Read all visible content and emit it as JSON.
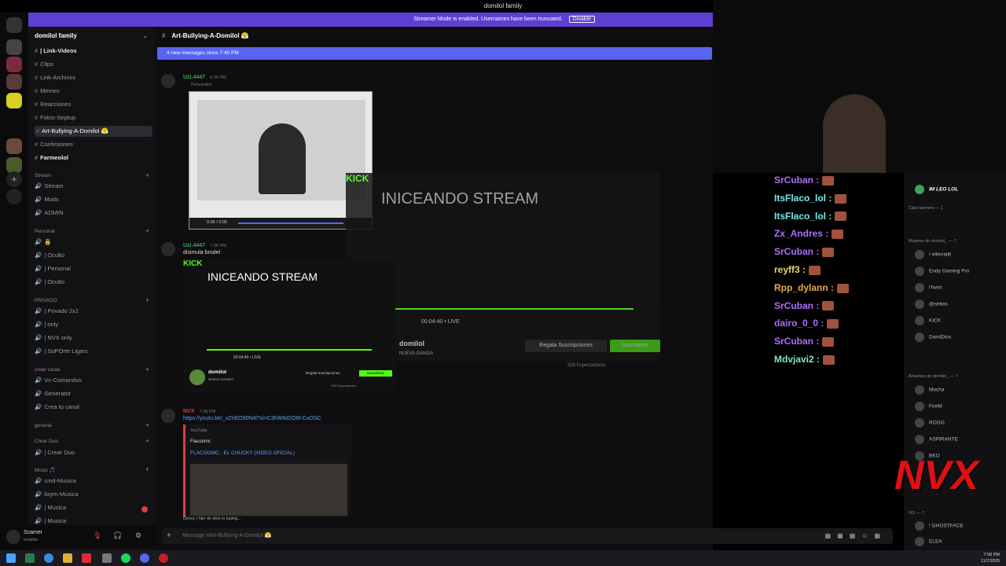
{
  "titlebar": {
    "title": "domilol family"
  },
  "banner": {
    "text": "Streamer Mode is enabled. Usernames have been truncated.",
    "disable_label": "Disable"
  },
  "server": {
    "name": "domilol family"
  },
  "channel_header": {
    "name": "Art-Bullying-A-Domilol",
    "emoji": "😤"
  },
  "new_messages": {
    "text": "4 new messages since 7:40 PM"
  },
  "channels": [
    {
      "label": "| Link-Videos",
      "style": "bright"
    },
    {
      "label": "Clips"
    },
    {
      "label": "Link-Archivos"
    },
    {
      "label": "Memes"
    },
    {
      "label": "Reacciones"
    },
    {
      "label": "Fotos-Septup"
    },
    {
      "label": "Art-Bullying-A-Domilol 😤",
      "style": "active"
    },
    {
      "label": "Confesiones"
    },
    {
      "label": "Farmeolol",
      "style": "bright"
    }
  ],
  "categories": {
    "streams": "Stream",
    "personal": "Personal",
    "privado": "PRIVADO",
    "crear_canal": "crear canal",
    "general": "general",
    "crear_duo": "Crear Duo",
    "music": "Music 🎵"
  },
  "voice_stream": [
    {
      "label": "Stream"
    },
    {
      "label": "Mods"
    },
    {
      "label": "ADMIN"
    }
  ],
  "voice_personal": [
    {
      "label": "🔒"
    },
    {
      "label": "| Oculto"
    },
    {
      "label": "| Personal"
    },
    {
      "label": "| Oculto"
    }
  ],
  "voice_privado": [
    {
      "label": "| Privado 2x2"
    },
    {
      "label": "| only"
    },
    {
      "label": "| NVX only"
    },
    {
      "label": "| SoPOrte Ligars"
    }
  ],
  "voice_crear": [
    {
      "label": "Vc-Comandos"
    },
    {
      "label": "Generator"
    },
    {
      "label": "Crea tu canal"
    }
  ],
  "voice_duo": [
    {
      "label": "| Crear Duo"
    }
  ],
  "voice_music": [
    {
      "label": "cmd-Musica"
    },
    {
      "label": "lixym-Musica"
    },
    {
      "label": "| Musica"
    },
    {
      "label": "| Musica"
    }
  ],
  "messages": {
    "m1_user": "Uzi.4447",
    "m1_time": "6:26 PM",
    "m1_forwarded": "Forwarded",
    "m1_video_time": "0:06 / 0:06",
    "m2_user": "Uzi.4447",
    "m2_time": "7:38 PM",
    "m2_text": "disimula brodel",
    "m3_user": "NVX",
    "m3_time": "7:38 PM",
    "m3_link": "https://youtu.be/_xZnEO90N4l?si=C3hW6d2OM-CuOSC",
    "embed_site": "YouTube",
    "embed_author": "Flacoomc",
    "embed_title": "FLACOOMC - EL CHUCKY (VIDEO OFICIAL)",
    "typing": "Dexxy | hijo de dios is typing..."
  },
  "stream_overlay": {
    "title": "INICEANDO STREAM",
    "live_time": "00:04:40",
    "live_label": "LIVE",
    "streamer": "domilol",
    "tagline": "NUEVA GANGA",
    "gift_label": "Regala Suscripciones",
    "sub_label": "Suscribirse",
    "viewers": "328 Espectadores",
    "kick": "KICK"
  },
  "stream_chat": [
    {
      "user": "SrCuban :",
      "color": "#b06cff"
    },
    {
      "user": "ItsFlaco_lol :",
      "color": "#7ee6e6"
    },
    {
      "user": "ItsFlaco_lol :",
      "color": "#7ee6e6"
    },
    {
      "user": "Zx_Andres :",
      "color": "#b06cff"
    },
    {
      "user": "SrCuban :",
      "color": "#b06cff"
    },
    {
      "user": "reyff3 :",
      "color": "#e8d66a"
    },
    {
      "user": "Rpp_dylann :",
      "color": "#e8a94a"
    },
    {
      "user": "SrCuban :",
      "color": "#b06cff"
    },
    {
      "user": "dairo_0_0 :",
      "color": "#b06cff"
    },
    {
      "user": "SrCuban :",
      "color": "#b06cff"
    },
    {
      "user": "Mdvjavi2 :",
      "color": "#7ee6c0"
    }
  ],
  "members": {
    "top_name": "IM LEO LOL",
    "cat1": "Clips farmers — 1",
    "cat2": "Mujeres de domilol_ — 7",
    "cat3": "Amantes de domilol_ — 7",
    "cat4": "OG — 7",
    "list2": [
      "! elferralill",
      "Endy Gaming Pro",
      "iTwist",
      "@sebas",
      "KICK",
      "DomiDios"
    ],
    "list3": [
      "Mocha",
      "FireM",
      "ROGG",
      "ASPIRANTE",
      "BKO"
    ],
    "list4": [
      "! GHOSTFACE",
      "ELEA",
      "lil.uis7"
    ]
  },
  "user": {
    "name": "Scamer",
    "status": "Invisible"
  },
  "composer": {
    "placeholder": "Message #Art-Bullying-A-Domilol 😤"
  },
  "clock": {
    "time": "7:58 PM",
    "date": "11/7/2025"
  },
  "brand": {
    "nvx": "NVX"
  },
  "colors": {
    "banner": "#5d3fd3",
    "accent": "#5865f2",
    "kick_green": "#53fc18"
  }
}
